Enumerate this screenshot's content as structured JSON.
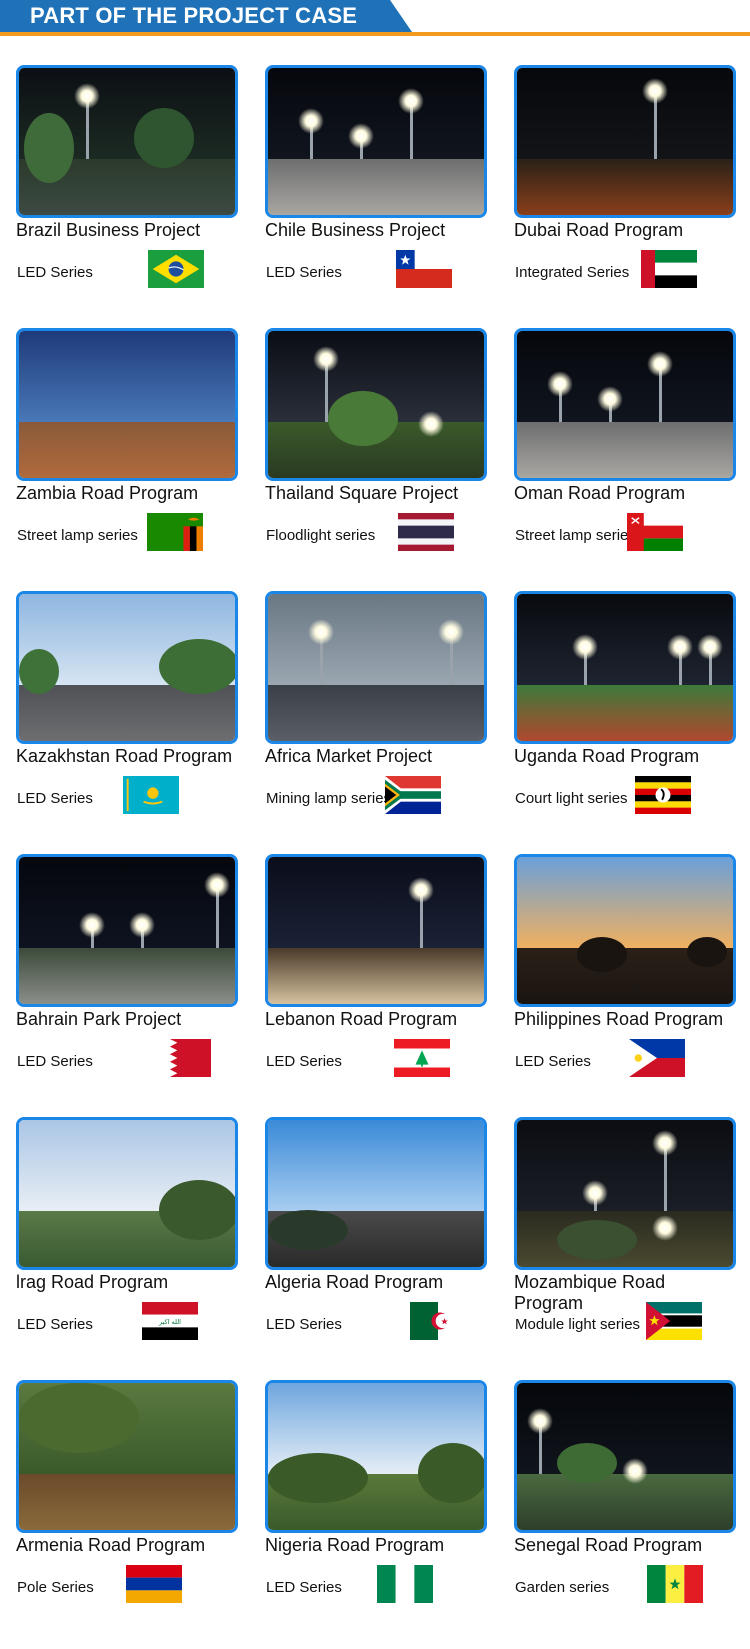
{
  "header": {
    "title": "PART OF THE PROJECT CASE"
  },
  "colors": {
    "accent": "#1f72b8",
    "underline": "#f39a1c",
    "frame": "#1a86e8"
  },
  "projects": [
    {
      "name": "Brazil Business Project",
      "series": "LED Series",
      "flag": "brazil-flag-icon",
      "scene": "night-trees"
    },
    {
      "name": "Chile Business Project",
      "series": "LED Series",
      "flag": "chile-flag-icon",
      "scene": "night-road"
    },
    {
      "name": "Dubai Road Program",
      "series": "Integrated Series",
      "flag": "uae-flag-icon",
      "scene": "night-workers"
    },
    {
      "name": "Zambia Road Program",
      "series": "Street lamp series",
      "flag": "zambia-flag-icon",
      "scene": "dusk-field"
    },
    {
      "name": "Thailand Square Project",
      "series": "Floodlight series",
      "flag": "thailand-flag-icon",
      "scene": "night-square"
    },
    {
      "name": "Oman Road Program",
      "series": "Street lamp series",
      "flag": "oman-flag-icon",
      "scene": "night-road"
    },
    {
      "name": "Kazakhstan Road Program",
      "series": "LED Series",
      "flag": "kazakhstan-flag-icon",
      "scene": "day-road"
    },
    {
      "name": "Africa Market Project",
      "series": "Mining lamp series",
      "flag": "south-africa-flag-icon",
      "scene": "warehouse"
    },
    {
      "name": "Uganda Road Program",
      "series": "Court light series",
      "flag": "uganda-flag-icon",
      "scene": "night-stadium"
    },
    {
      "name": "Bahrain Park Project",
      "series": "LED Series",
      "flag": "bahrain-flag-icon",
      "scene": "night-park"
    },
    {
      "name": "Lebanon Road Program",
      "series": "LED Series",
      "flag": "lebanon-flag-icon",
      "scene": "night-building"
    },
    {
      "name": "Philippines Road Program",
      "series": "LED Series",
      "flag": "philippines-flag-icon",
      "scene": "sunset-crane"
    },
    {
      "name": "lrag Road Program",
      "series": "LED Series",
      "flag": "iraq-flag-icon",
      "scene": "cloudy-day"
    },
    {
      "name": "Algeria Road Program",
      "series": "LED Series",
      "flag": "algeria-flag-icon",
      "scene": "blue-day"
    },
    {
      "name": "Mozambique Road Program",
      "series": "Module light series",
      "flag": "mozambique-flag-icon",
      "scene": "night-palm"
    },
    {
      "name": "Armenia Road Program",
      "series": "Pole Series",
      "flag": "armenia-flag-icon",
      "scene": "day-crew"
    },
    {
      "name": "Nigeria Road Program",
      "series": "LED Series",
      "flag": "nigeria-flag-icon",
      "scene": "day-field"
    },
    {
      "name": "Senegal Road Program",
      "series": "Garden series",
      "flag": "senegal-flag-icon",
      "scene": "night-lawn"
    }
  ]
}
